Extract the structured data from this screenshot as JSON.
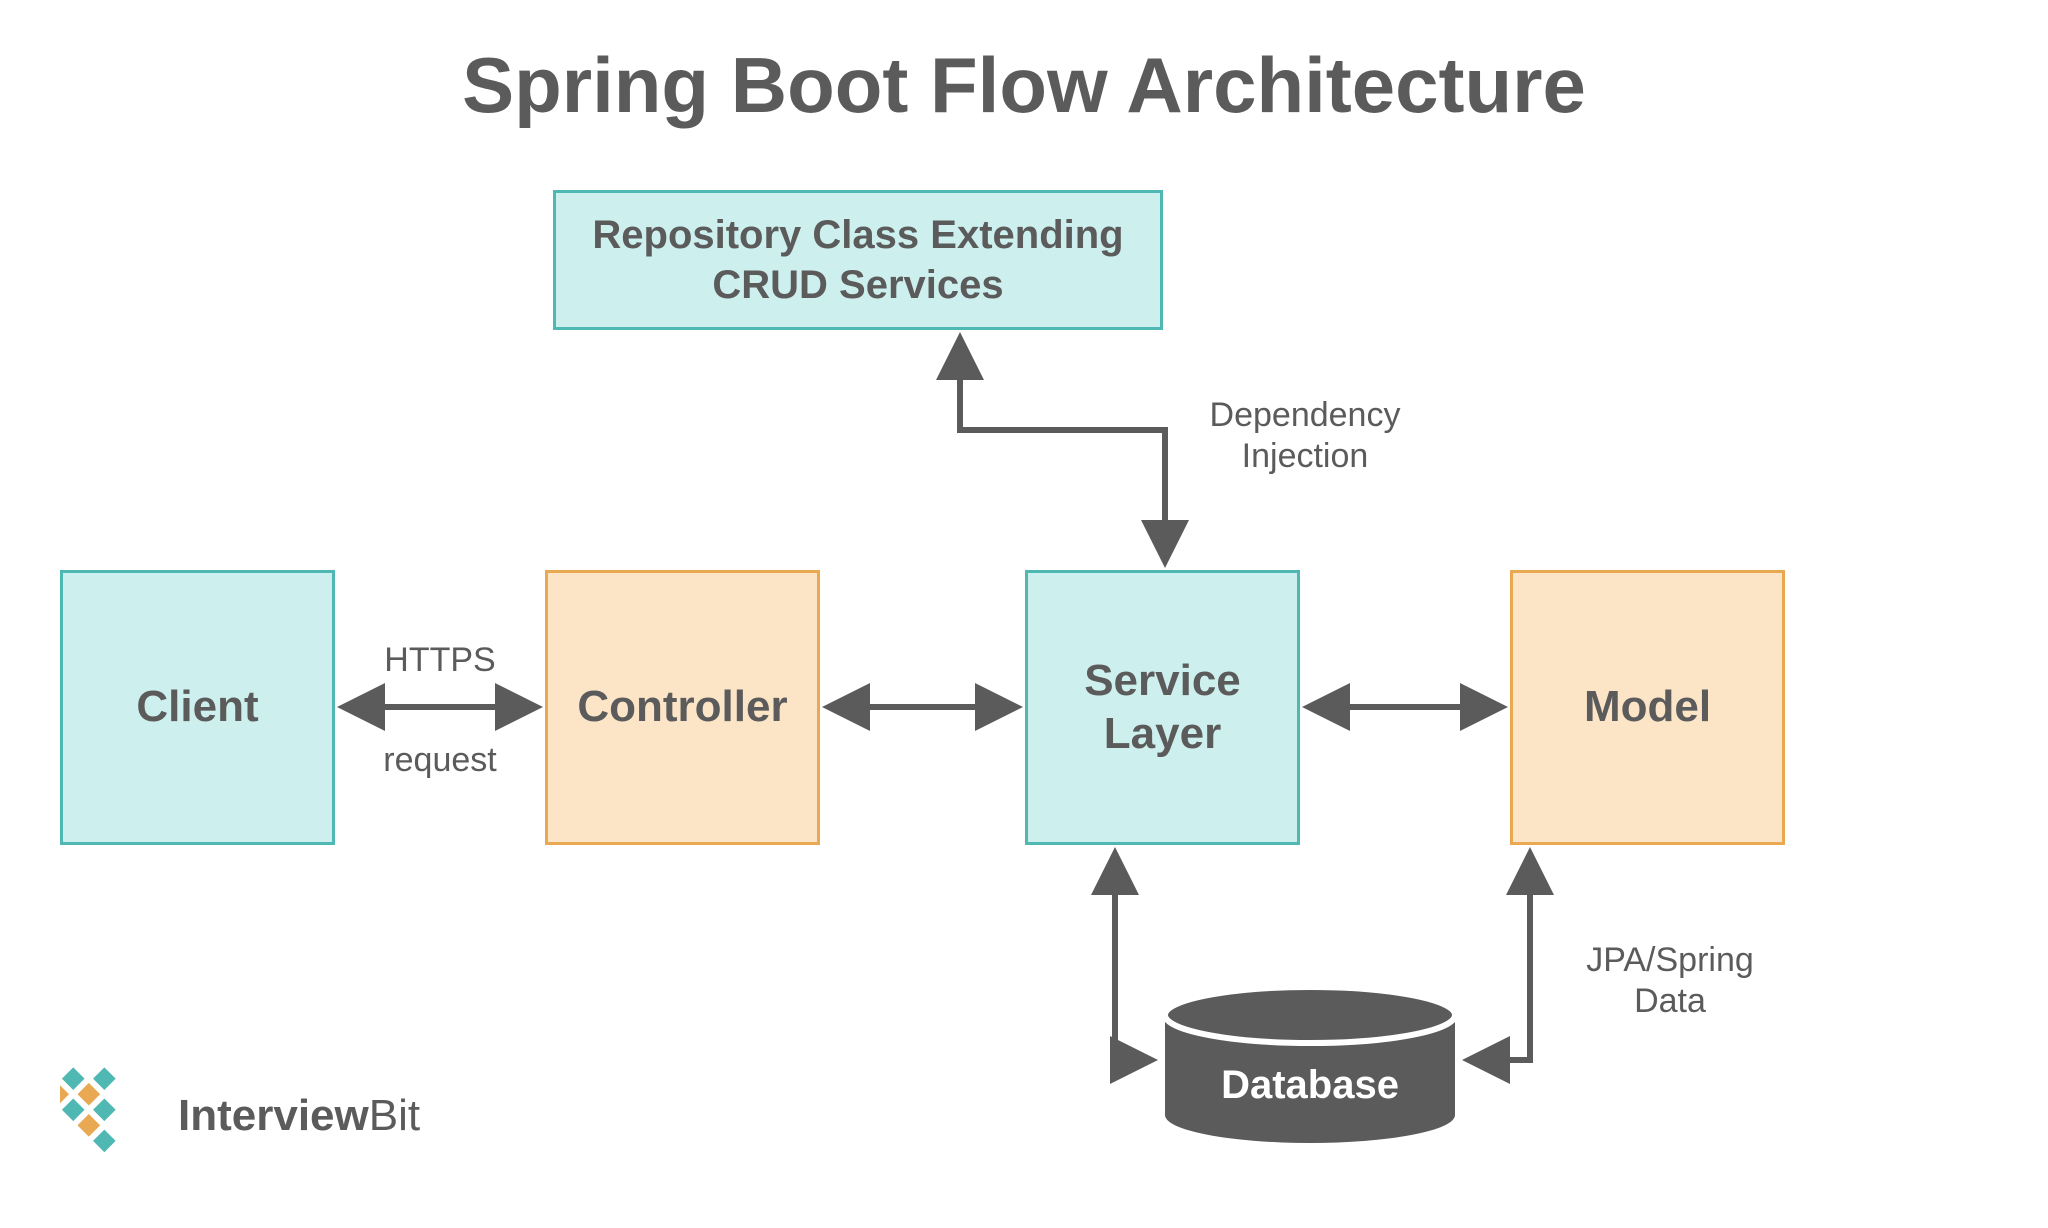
{
  "title": "Spring Boot Flow Architecture",
  "boxes": {
    "repository": "Repository Class Extending\nCRUD Services",
    "client": "Client",
    "controller": "Controller",
    "service": "Service\nLayer",
    "model": "Model",
    "database": "Database"
  },
  "labels": {
    "https": "HTTPS",
    "request": "request",
    "dependency_injection": "Dependency\nInjection",
    "jpa_spring_data": "JPA/Spring\nData"
  },
  "logo": {
    "brand_bold": "Interview",
    "brand_light": "Bit"
  },
  "colors": {
    "teal_fill": "#cdf0ee",
    "teal_border": "#4fb8b3",
    "orange_fill": "#fce4c7",
    "orange_border": "#e9a852",
    "arrow": "#5b5b5b",
    "db": "#5b5b5b"
  }
}
